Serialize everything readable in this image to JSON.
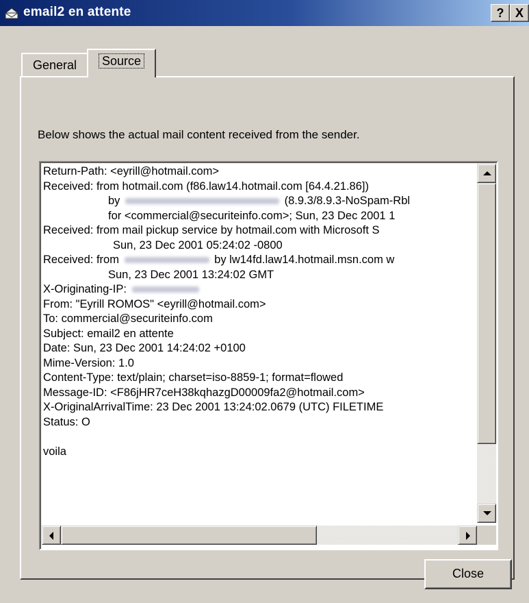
{
  "window": {
    "title": "email2 en attente",
    "help_label": "?",
    "close_label": "X"
  },
  "tabs": [
    {
      "label": "General",
      "selected": false
    },
    {
      "label": "Source",
      "selected": true
    }
  ],
  "panel": {
    "description": "Below shows the actual mail content received from the sender."
  },
  "source": {
    "l1": "Return-Path: <eyrill@hotmail.com>",
    "l2": "Received: from hotmail.com (f86.law14.hotmail.com [64.4.21.86])",
    "l3_a": "by",
    "l3_b": "(8.9.3/8.9.3-NoSpam-Rbl",
    "l4": "for <commercial@securiteinfo.com>; Sun, 23 Dec 2001 1",
    "l5": "Received: from mail pickup service by hotmail.com with Microsoft S",
    "l6": "Sun, 23 Dec 2001 05:24:02 -0800",
    "l7_a": "Received: from",
    "l7_b": "by lw14fd.law14.hotmail.msn.com w",
    "l8": "Sun, 23 Dec 2001 13:24:02 GMT",
    "l9": "X-Originating-IP:",
    "l10": "From: \"Eyrill ROMOS\" <eyrill@hotmail.com>",
    "l11": "To: commercial@securiteinfo.com",
    "l12": "Subject: email2 en attente",
    "l13": "Date: Sun, 23 Dec 2001 14:24:02 +0100",
    "l14": "Mime-Version: 1.0",
    "l15": "Content-Type: text/plain; charset=iso-8859-1; format=flowed",
    "l16": "Message-ID: <F86jHR7ceH38kqhazgD00009fa2@hotmail.com>",
    "l17": "X-OriginalArrivalTime: 23 Dec 2001 13:24:02.0679 (UTC) FILETIME",
    "l18": "Status:  O",
    "l19": "",
    "l20": "voila"
  },
  "buttons": {
    "close": "Close"
  },
  "colors": {
    "titlebar_start": "#0a246a",
    "titlebar_end": "#a6caf0",
    "face": "#d4d0c8"
  },
  "icons": {
    "title": "mail-envelope-icon"
  }
}
